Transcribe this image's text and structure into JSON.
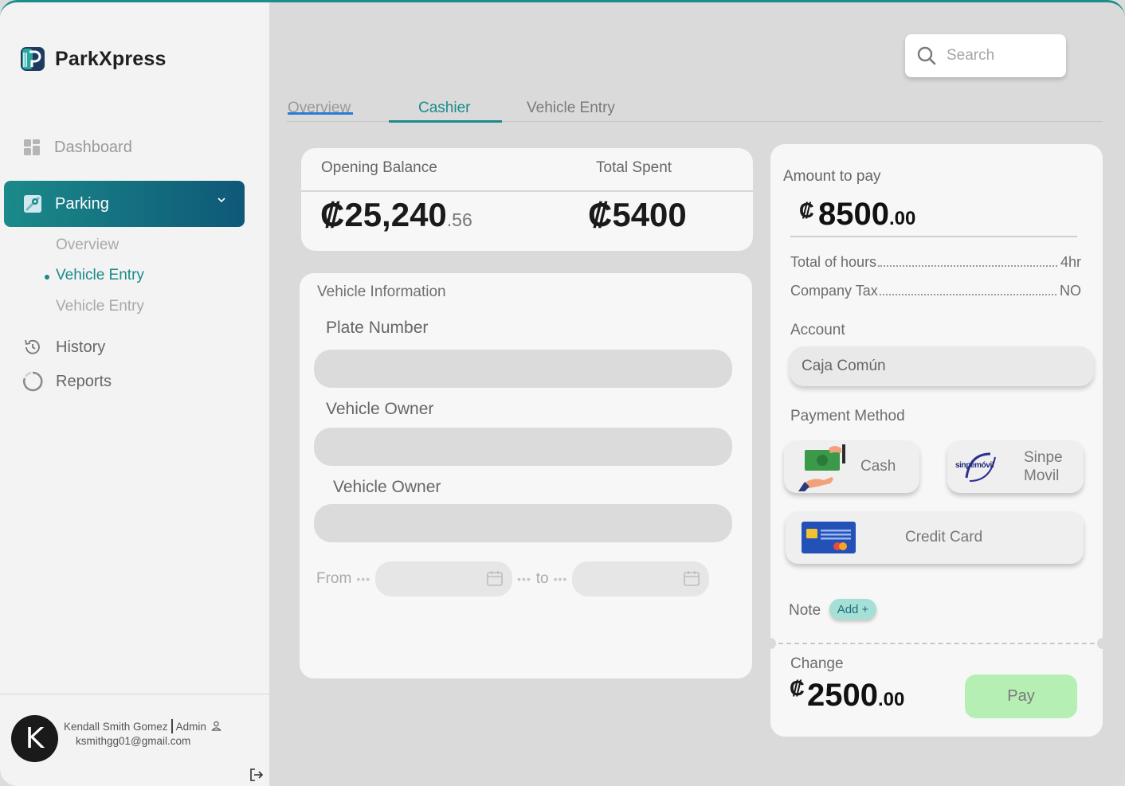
{
  "app": {
    "name": "ParkXpress"
  },
  "sidebar": {
    "dashboard_label": "Dashboard",
    "parking_label": "Parking",
    "sub_items": [
      {
        "label": "Overview"
      },
      {
        "label": "Vehicle Entry"
      },
      {
        "label": "Vehicle Entry"
      }
    ],
    "history_label": "History",
    "reports_label": "Reports"
  },
  "user": {
    "initial": "K",
    "name": "Kendall Smith Gomez",
    "role": "Admin",
    "email": "ksmithgg01@gmail.com"
  },
  "search": {
    "placeholder": "Search"
  },
  "tabs": [
    {
      "label": "Overview"
    },
    {
      "label": "Cashier"
    },
    {
      "label": "Vehicle Entry"
    }
  ],
  "balance": {
    "opening_label": "Opening Balance",
    "opening_main": "₡25,240",
    "opening_cents": ".56",
    "spent_label": "Total Spent",
    "spent_value": "₡5400"
  },
  "vehicle_info": {
    "title": "Vehicle Information",
    "plate_label": "Plate Number",
    "owner_label": "Vehicle Owner",
    "owner2_label": "Vehicle Owner",
    "from_label": "From",
    "to_label": "to"
  },
  "payment": {
    "amount_label": "Amount to pay",
    "currency": "₡",
    "amount_main": "8500",
    "amount_cents": ".00",
    "hours_label": "Total of hours",
    "hours_value": "4hr",
    "tax_label": "Company Tax",
    "tax_value": "NO",
    "account_label": "Account",
    "account_value": "Caja Común",
    "method_label": "Payment Method",
    "methods": {
      "cash": "Cash",
      "sinpe_line1": "Sinpe",
      "sinpe_line2": "Movil",
      "sinpe_logo_text": "sinpemóvil",
      "card": "Credit Card"
    },
    "note_label": "Note",
    "add_label": "Add +",
    "change_label": "Change",
    "change_main": "2500",
    "change_cents": ".00",
    "pay_label": "Pay"
  },
  "colors": {
    "accent": "#1b8a8a",
    "pay_button": "#b6efb4",
    "add_button": "#a6dfd6"
  }
}
